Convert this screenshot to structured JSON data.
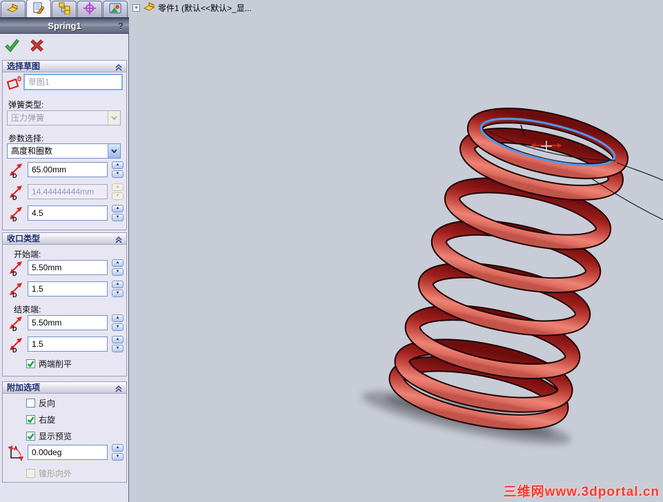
{
  "colors": {
    "selection_blue": "#4f97ea",
    "spring_red": "#c0392f",
    "panel_bg": "#e3e2ef",
    "viewport_bg": "#c8ccd7",
    "watermark_red": "#f03c32"
  },
  "panel": {
    "title": "Spring1",
    "help": "?",
    "sketch": {
      "header": "选择草图",
      "count_badge": "0",
      "value": "草图1",
      "type_label": "弹簧类型:",
      "type_value": "压力弹簧",
      "param_label": "参数选择:",
      "param_value": "高度和圈数",
      "height_value": "65.00mm",
      "pitch_value": "14.44444444mm",
      "coils_value": "4.5"
    },
    "ends": {
      "header": "收口类型",
      "start_label": "开始端:",
      "start_pitch": "5.50mm",
      "start_turns": "1.5",
      "end_label": "结束端:",
      "end_pitch": "5.50mm",
      "end_turns": "1.5",
      "flatten_label": "两端削平"
    },
    "options": {
      "header": "附加选项",
      "reverse_label": "反向",
      "righthand_label": "右旋",
      "preview_label": "显示预览",
      "angle_value": "0.00deg",
      "taper_label": "锥形向外"
    }
  },
  "viewport": {
    "tree_item": "零件1 (默认<<默认>_显...",
    "watermark": "三维网www.3dportal.cn"
  }
}
